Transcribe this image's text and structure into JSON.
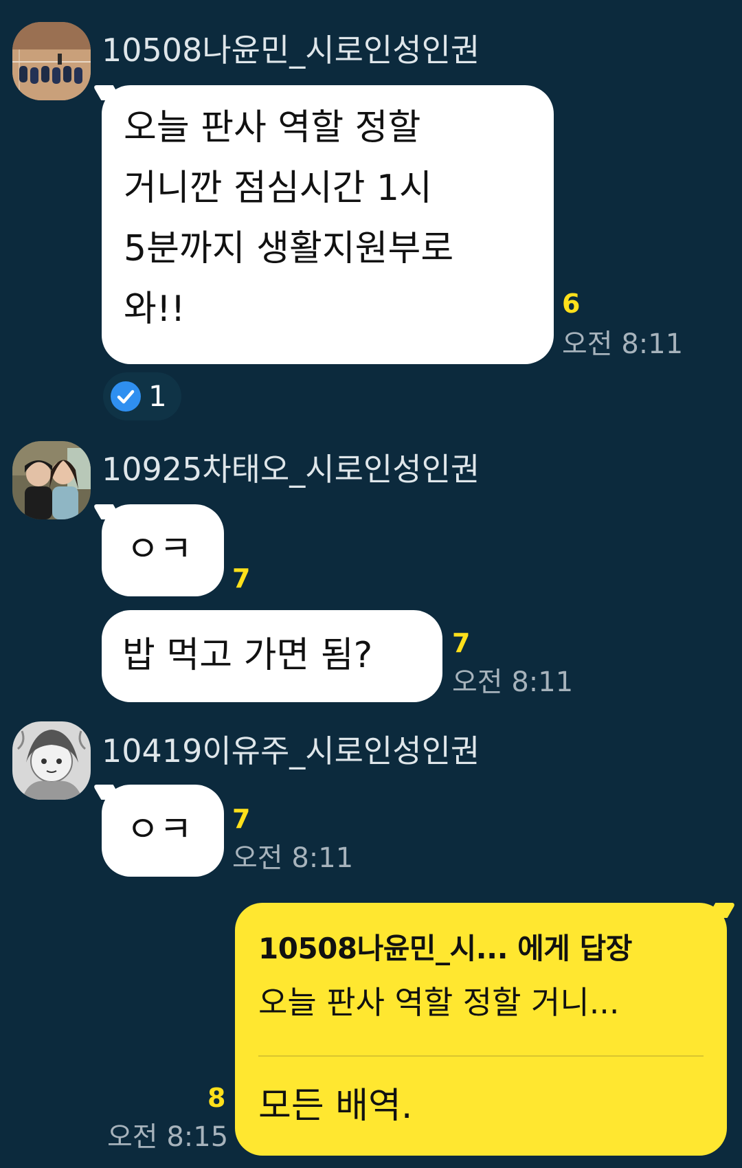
{
  "messages": [
    {
      "sender": "10508나윤민_시로인성인권",
      "bubbles": [
        {
          "lines": [
            "오늘 판사 역할 정할",
            "거니깐 점심시간 1시",
            "5분까지 생활지원부로",
            "와!!"
          ],
          "unread": "6",
          "time": "오전 8:11"
        }
      ],
      "reaction": {
        "icon": "checkmark-icon",
        "count": "1"
      }
    },
    {
      "sender": "10925차태오_시로인성인권",
      "bubbles": [
        {
          "lines": [
            "ㅇㅋ"
          ],
          "unread": "7"
        },
        {
          "lines": [
            "밥 먹고 가면 됨?"
          ],
          "unread": "7",
          "time": "오전 8:11"
        }
      ]
    },
    {
      "sender": "10419이유주_시로인성인권",
      "bubbles": [
        {
          "lines": [
            "ㅇㅋ"
          ],
          "unread": "7",
          "time": "오전 8:11"
        }
      ]
    }
  ],
  "my_reply": {
    "reply_to": "10508나윤민_시...  에게 답장",
    "quoted_preview": "오늘 판사 역할 정할 거니...",
    "text": "모든 배역.",
    "unread": "8",
    "time": "오전 8:15"
  },
  "colors": {
    "background": "#0c2a3d",
    "my_bubble": "#ffe730",
    "other_bubble": "#ffffff",
    "unread_count": "#ffe01b",
    "timestamp": "#a7b3bc",
    "reaction_check": "#2f8ff0"
  }
}
